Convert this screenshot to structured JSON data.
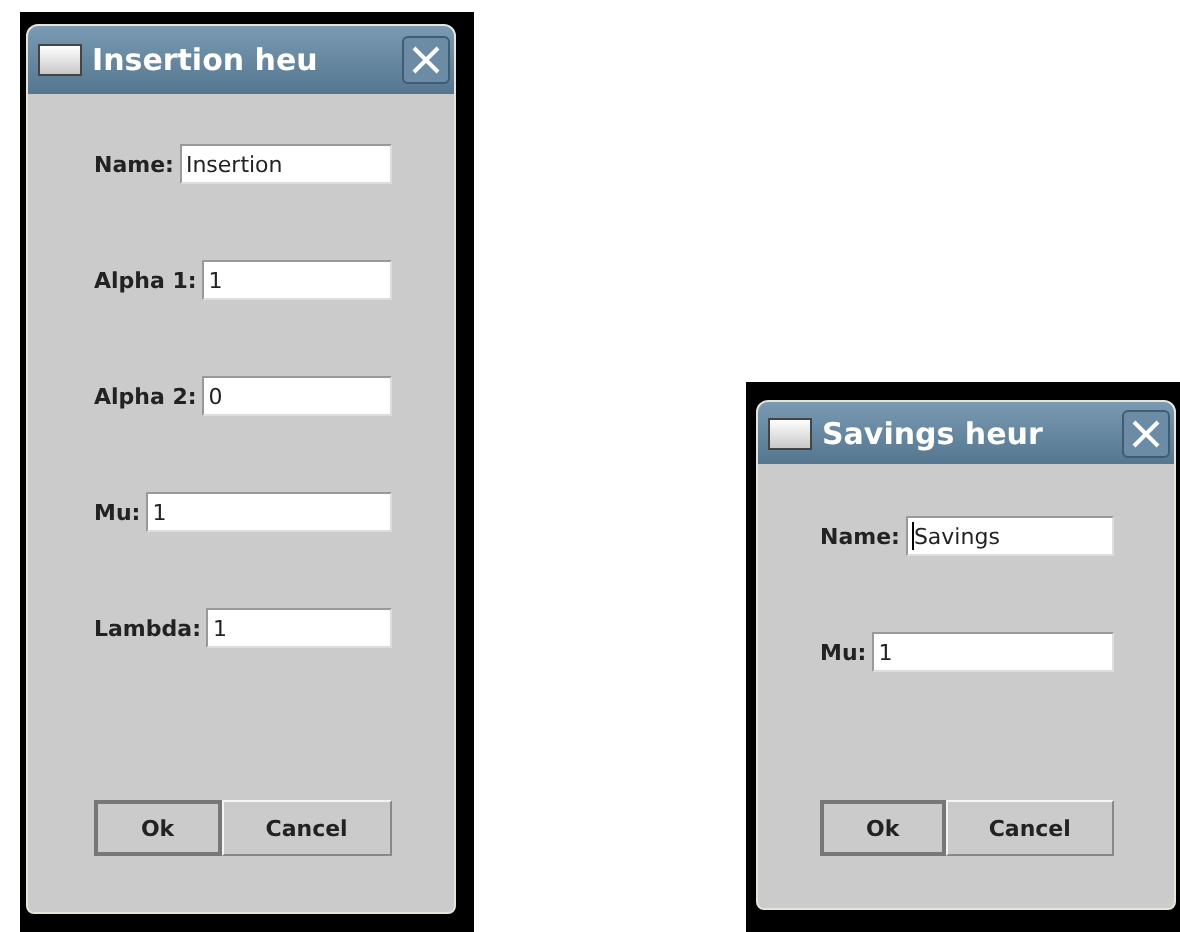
{
  "windows": [
    {
      "title": "Insertion heu",
      "fields": [
        {
          "label": "Name:",
          "value": "Insertion",
          "focused": false
        },
        {
          "label": "Alpha 1:",
          "value": "1",
          "focused": false
        },
        {
          "label": "Alpha 2:",
          "value": "0",
          "focused": false
        },
        {
          "label": "Mu:",
          "value": "1",
          "focused": false
        },
        {
          "label": "Lambda:",
          "value": "1",
          "focused": false
        }
      ],
      "buttons": [
        {
          "label": "Ok",
          "default": true
        },
        {
          "label": "Cancel",
          "default": false
        }
      ]
    },
    {
      "title": "Savings heur",
      "fields": [
        {
          "label": "Name:",
          "value": "Savings",
          "focused": true
        },
        {
          "label": "Mu:",
          "value": "1",
          "focused": false
        }
      ],
      "buttons": [
        {
          "label": "Ok",
          "default": true
        },
        {
          "label": "Cancel",
          "default": false
        }
      ]
    }
  ]
}
